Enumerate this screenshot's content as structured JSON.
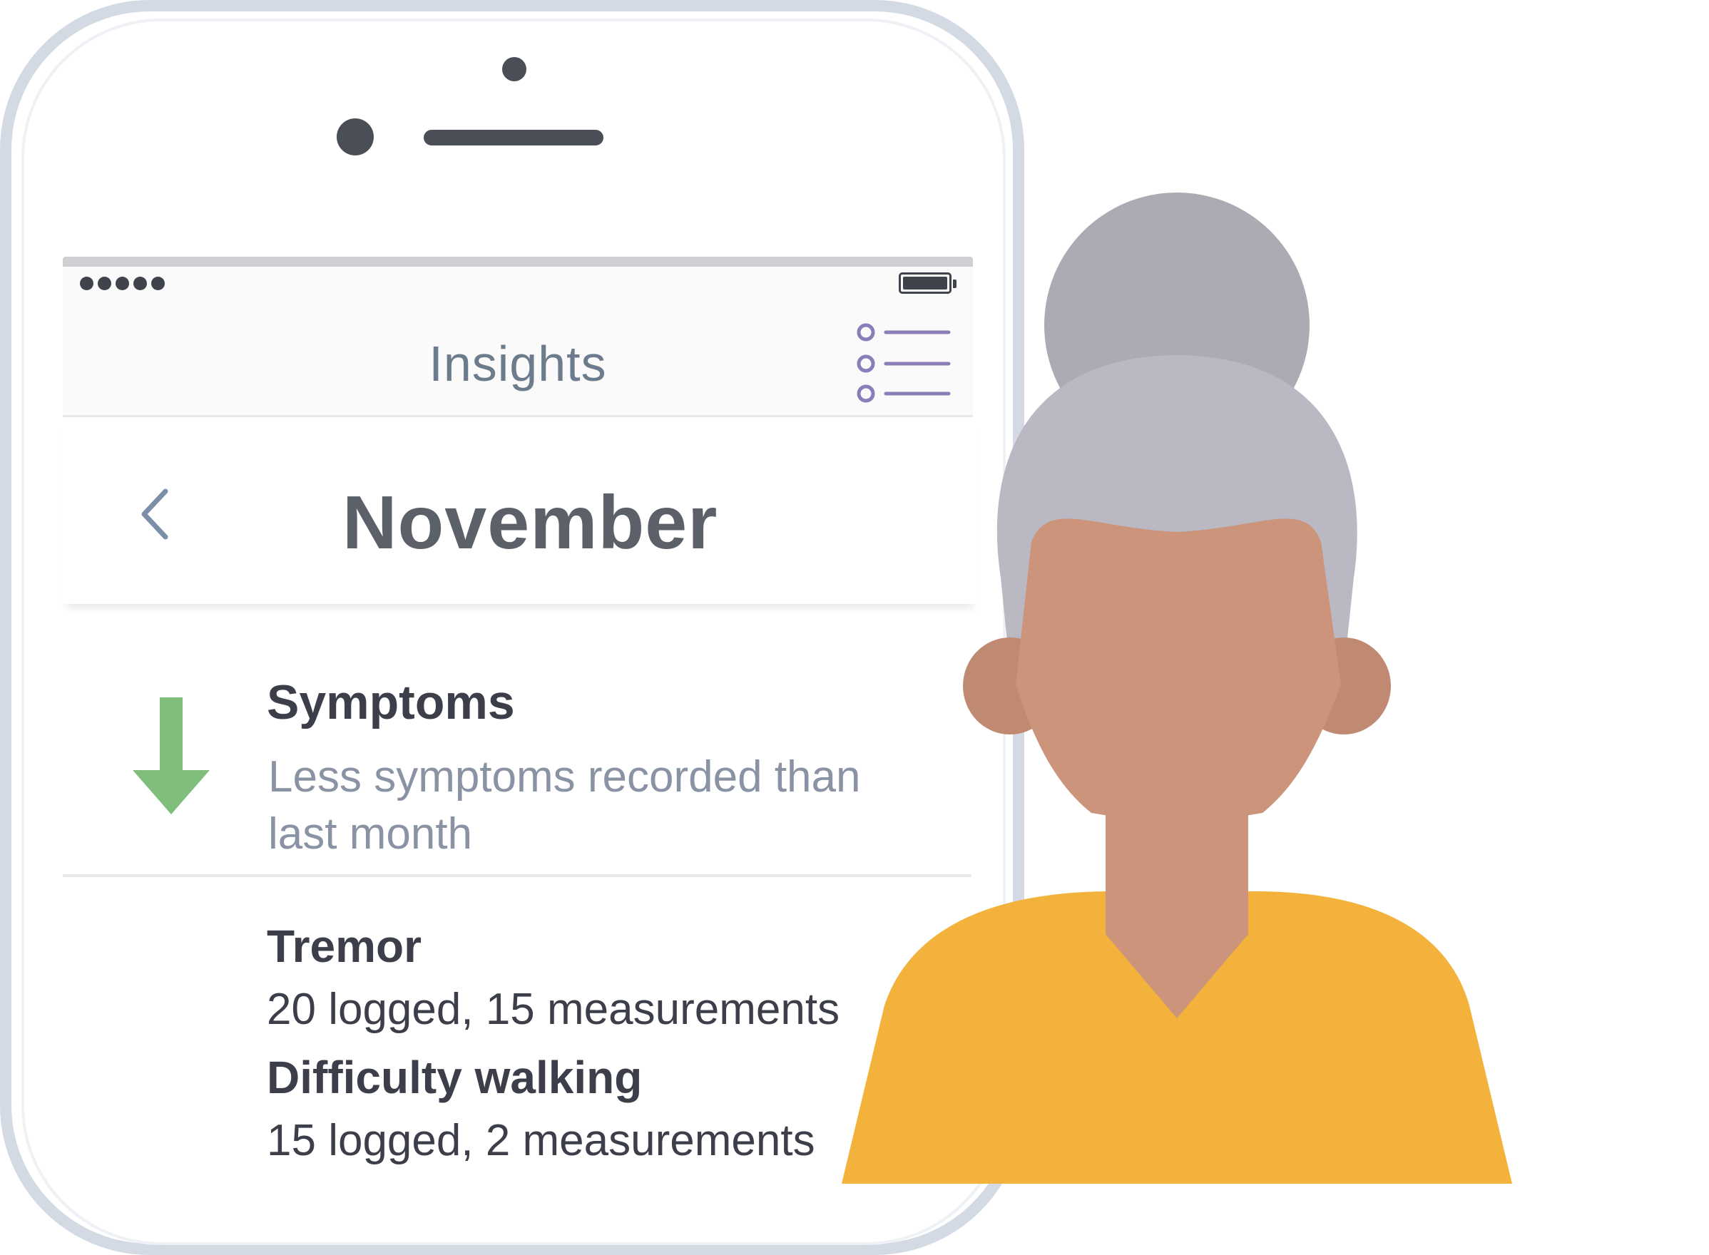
{
  "app": {
    "header": {
      "title": "Insights"
    },
    "page": {
      "title": "November"
    },
    "summary": {
      "title": "Symptoms",
      "subtitle_line1": "Less symptoms recorded than",
      "subtitle_line2": "last month",
      "trend": "down",
      "trend_color": "#7fbf7b"
    },
    "symptoms": [
      {
        "name": "Tremor",
        "detail": "20 logged, 15 measurements"
      },
      {
        "name": "Difficulty walking",
        "detail": "15 logged, 2 measurements"
      }
    ],
    "icons": {
      "menu": "list-icon",
      "back": "chevron-left-icon",
      "trend": "arrow-down-icon"
    },
    "colors": {
      "accent": "#8a7db8",
      "phone_frame": "#d3dae3",
      "avatar_shirt": "#f2b23c",
      "avatar_skin": "#cb947b",
      "avatar_hair": "#bab8c2"
    }
  }
}
